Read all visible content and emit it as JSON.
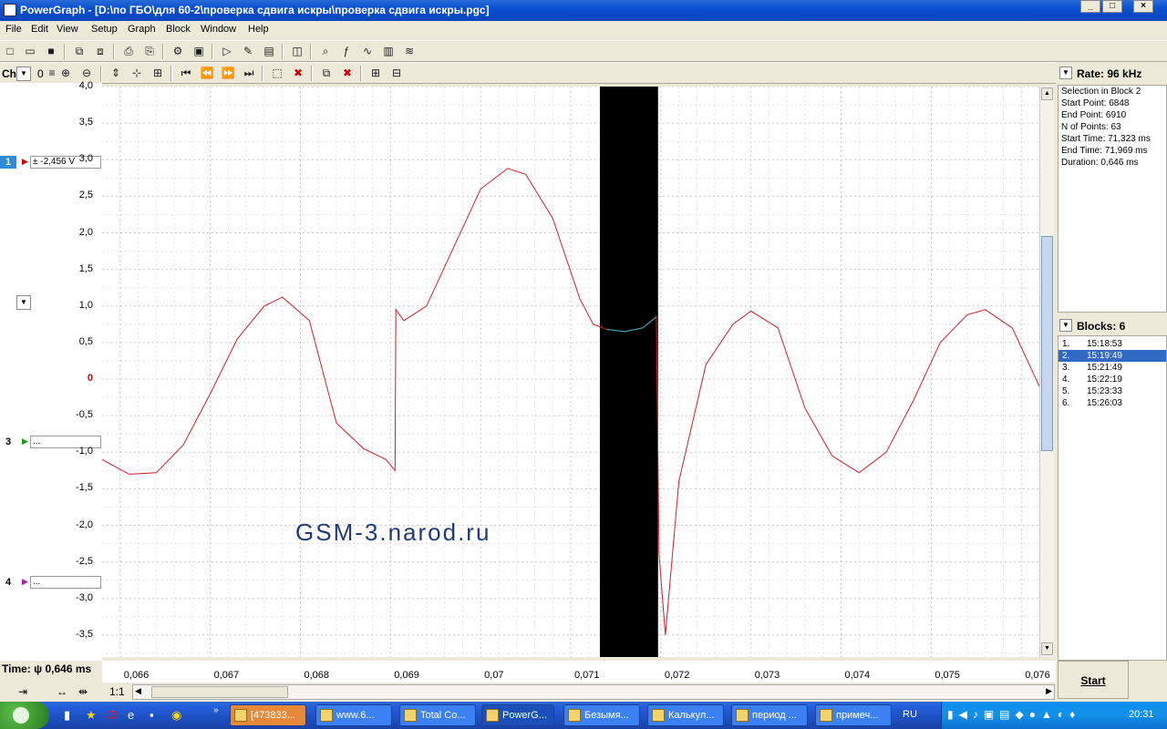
{
  "window": {
    "title": "PowerGraph - [D:\\по ГБО\\для 60-2\\проверка сдвига искры\\проверка сдвига искры.pgc]"
  },
  "menu": [
    "File",
    "Edit",
    "View",
    "Setup",
    "Graph",
    "Block",
    "Window",
    "Help"
  ],
  "toolbar2": {
    "ch_label": "Ch",
    "zero_label": "0"
  },
  "rate": {
    "label": "Rate: 96 kHz"
  },
  "selection_info": {
    "title": "Selection in Block 2",
    "start_point": "Start Point: 6848",
    "end_point": "End Point: 6910",
    "n_points": "N of Points: 63",
    "start_time": "Start Time: 71,323 ms",
    "end_time": "End Time: 71,969 ms",
    "duration": "Duration: 0,646 ms"
  },
  "blocks": {
    "label": "Blocks: 6",
    "items": [
      {
        "n": "1.",
        "time": "15:18:53"
      },
      {
        "n": "2.",
        "time": "15:19:49"
      },
      {
        "n": "3.",
        "time": "15:21:49"
      },
      {
        "n": "4.",
        "time": "15:22:19"
      },
      {
        "n": "5.",
        "time": "15:23:33"
      },
      {
        "n": "6.",
        "time": "15:26:03"
      }
    ],
    "selected": 1
  },
  "channels": {
    "ch1": {
      "num": "1",
      "value": "± -2,456 V"
    },
    "ch3": {
      "num": "3",
      "value": "..."
    },
    "ch4": {
      "num": "4",
      "value": "..."
    }
  },
  "y_ticks": [
    "4,0",
    "3,5",
    "3,0",
    "2,5",
    "2,0",
    "1,5",
    "1,0",
    "0,5",
    "0",
    "-0,5",
    "-1,0",
    "-1,5",
    "-2,0",
    "-2,5",
    "-3,0",
    "-3,5"
  ],
  "x_ticks": [
    "0,066",
    "0,067",
    "0,068",
    "0,069",
    "0,07",
    "0,071",
    "0,072",
    "0,073",
    "0,074",
    "0,075",
    "0,076"
  ],
  "time_readout": "Time: ψ 0,646 ms",
  "watermark": "GSM-3.narod.ru",
  "zoom_label": "1:1",
  "start_button": "Start",
  "colors": {
    "signal": "#d61a2a",
    "selection_signal": "#2ab8c8",
    "selection_bg": "#000000",
    "selected_block": "#316ac5"
  },
  "chart_data": {
    "type": "line",
    "x_unit": "s",
    "xlim": [
      0.0658,
      0.0762
    ],
    "ylim": [
      -3.8,
      4.0
    ],
    "selection": {
      "x_start": 0.071323,
      "x_end": 0.071969
    },
    "series": [
      {
        "x": [
          0.0658,
          0.0661,
          0.0664,
          0.0667,
          0.067,
          0.0673,
          0.0676,
          0.0678,
          0.0681,
          0.0684,
          0.0687,
          0.06895,
          0.06905,
          0.06906,
          0.06915,
          0.0694,
          0.0697,
          0.07,
          0.0703,
          0.0705,
          0.0708,
          0.0711,
          0.07125,
          0.0714,
          0.0716,
          0.0718,
          0.07195,
          0.07198,
          0.07205,
          0.0722,
          0.0725,
          0.0728,
          0.073,
          0.0733,
          0.0736,
          0.0739,
          0.0742,
          0.0745,
          0.0748,
          0.0751,
          0.0754,
          0.0756,
          0.0759,
          0.0762
        ],
        "y": [
          -1.1,
          -1.3,
          -1.28,
          -0.9,
          -0.2,
          0.55,
          1.0,
          1.12,
          0.8,
          -0.6,
          -0.95,
          -1.1,
          -1.25,
          0.95,
          0.8,
          1.0,
          1.8,
          2.6,
          2.88,
          2.8,
          2.2,
          1.1,
          0.75,
          0.68,
          0.65,
          0.7,
          0.85,
          -2.4,
          -3.5,
          -1.4,
          0.2,
          0.75,
          0.93,
          0.7,
          -0.4,
          -1.05,
          -1.28,
          -1.0,
          -0.3,
          0.5,
          0.88,
          0.95,
          0.7,
          -0.1
        ]
      }
    ]
  },
  "taskbar": {
    "items": [
      "[473833...",
      "www.6...",
      "Total Co...",
      "PowerG...",
      "Безымя...",
      "Калькул...",
      "период ...",
      "примеч..."
    ],
    "lang": "RU",
    "clock": "20:31"
  }
}
